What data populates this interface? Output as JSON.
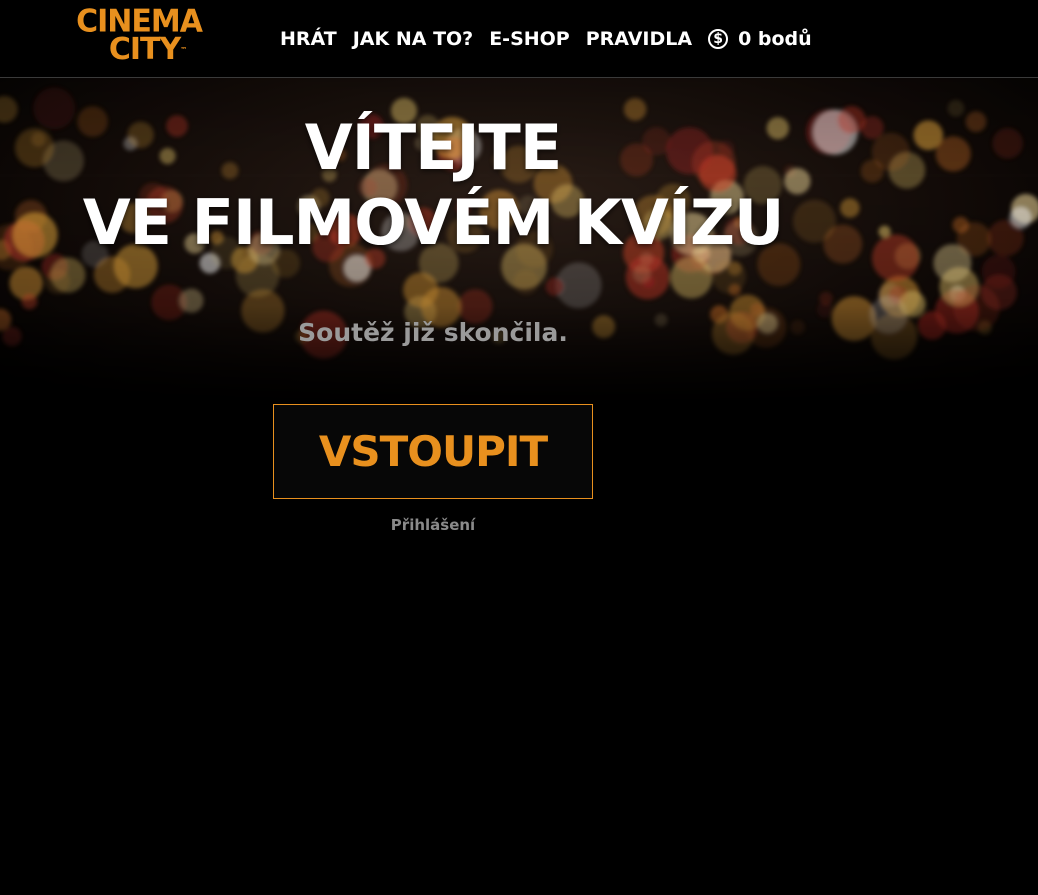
{
  "brand": {
    "logo_line1": "CINEMA",
    "logo_line2": "CITY",
    "trademark": "™"
  },
  "nav": {
    "items": [
      {
        "label": "HRÁT"
      },
      {
        "label": "JAK NA TO?"
      },
      {
        "label": "E-SHOP"
      },
      {
        "label": "PRAVIDLA"
      }
    ],
    "points_icon": "coin-dollar-icon",
    "points_symbol": "$",
    "points_label": "0 bodů"
  },
  "hero": {
    "title_line1": "VÍTEJTE",
    "title_line2": "VE FILMOVÉM KVÍZU",
    "status": "Soutěž již skončila."
  },
  "actions": {
    "enter_label": "VSTOUPIT",
    "login_label": "Přihlášení"
  },
  "colors": {
    "accent": "#e8901e",
    "background": "#000000",
    "muted_text": "#9a9a9a"
  }
}
